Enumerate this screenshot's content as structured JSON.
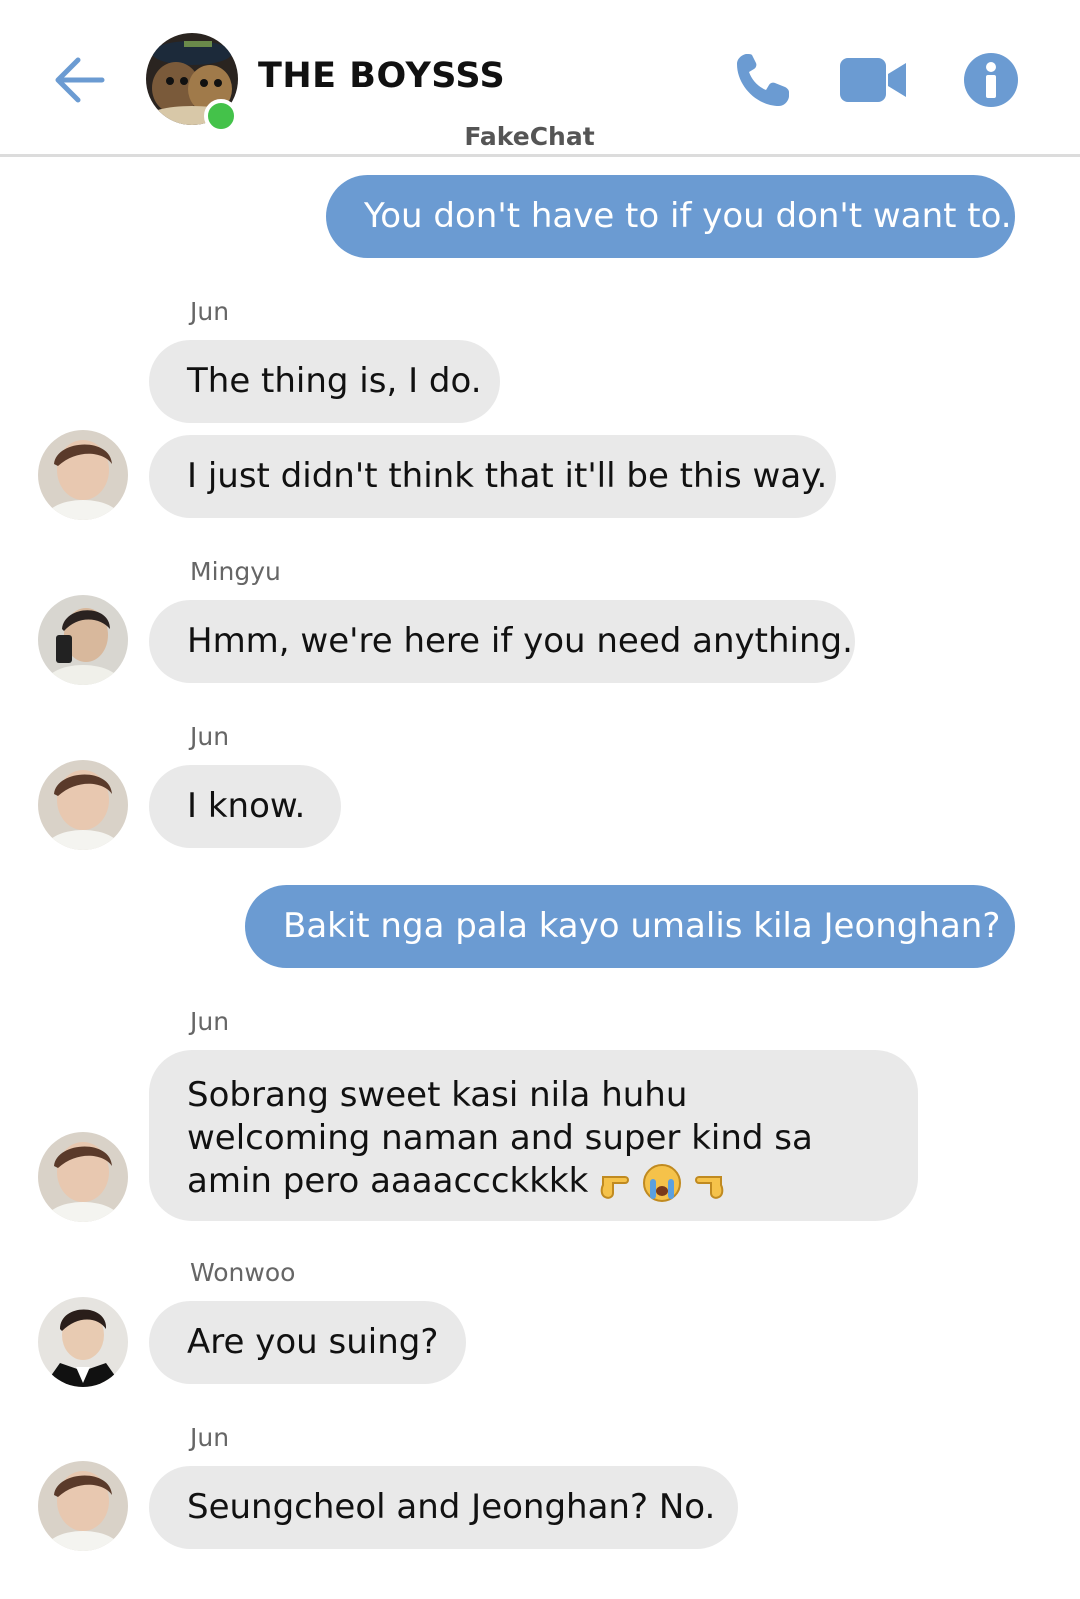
{
  "header": {
    "title": "THE BOYSSS",
    "subtitle": "FakeChat",
    "accent_color": "#6b9bd2",
    "online_color": "#44c24a"
  },
  "messages": [
    {
      "direction": "outgoing",
      "text": "You don't have to if you don't want to."
    },
    {
      "direction": "incoming",
      "sender": "Jun",
      "text": "The thing is, I do."
    },
    {
      "direction": "incoming",
      "text": "I just didn't think that it'll be this way."
    },
    {
      "direction": "incoming",
      "sender": "Mingyu",
      "text": "Hmm, we're here if you need anything."
    },
    {
      "direction": "incoming",
      "sender": "Jun",
      "text": "I know."
    },
    {
      "direction": "outgoing",
      "text": "Bakit nga pala kayo umalis kila Jeonghan?"
    },
    {
      "direction": "incoming",
      "sender": "Jun",
      "text": "Sobrang sweet kasi nila huhu welcoming naman and super kind sa amin pero aaaaccckkkk",
      "emoji": [
        "point-right-icon",
        "crying-face-icon",
        "point-left-icon"
      ]
    },
    {
      "direction": "incoming",
      "sender": "Wonwoo",
      "text": "Are you suing?"
    },
    {
      "direction": "incoming",
      "sender": "Jun",
      "text": "Seungcheol and Jeonghan? No."
    }
  ]
}
